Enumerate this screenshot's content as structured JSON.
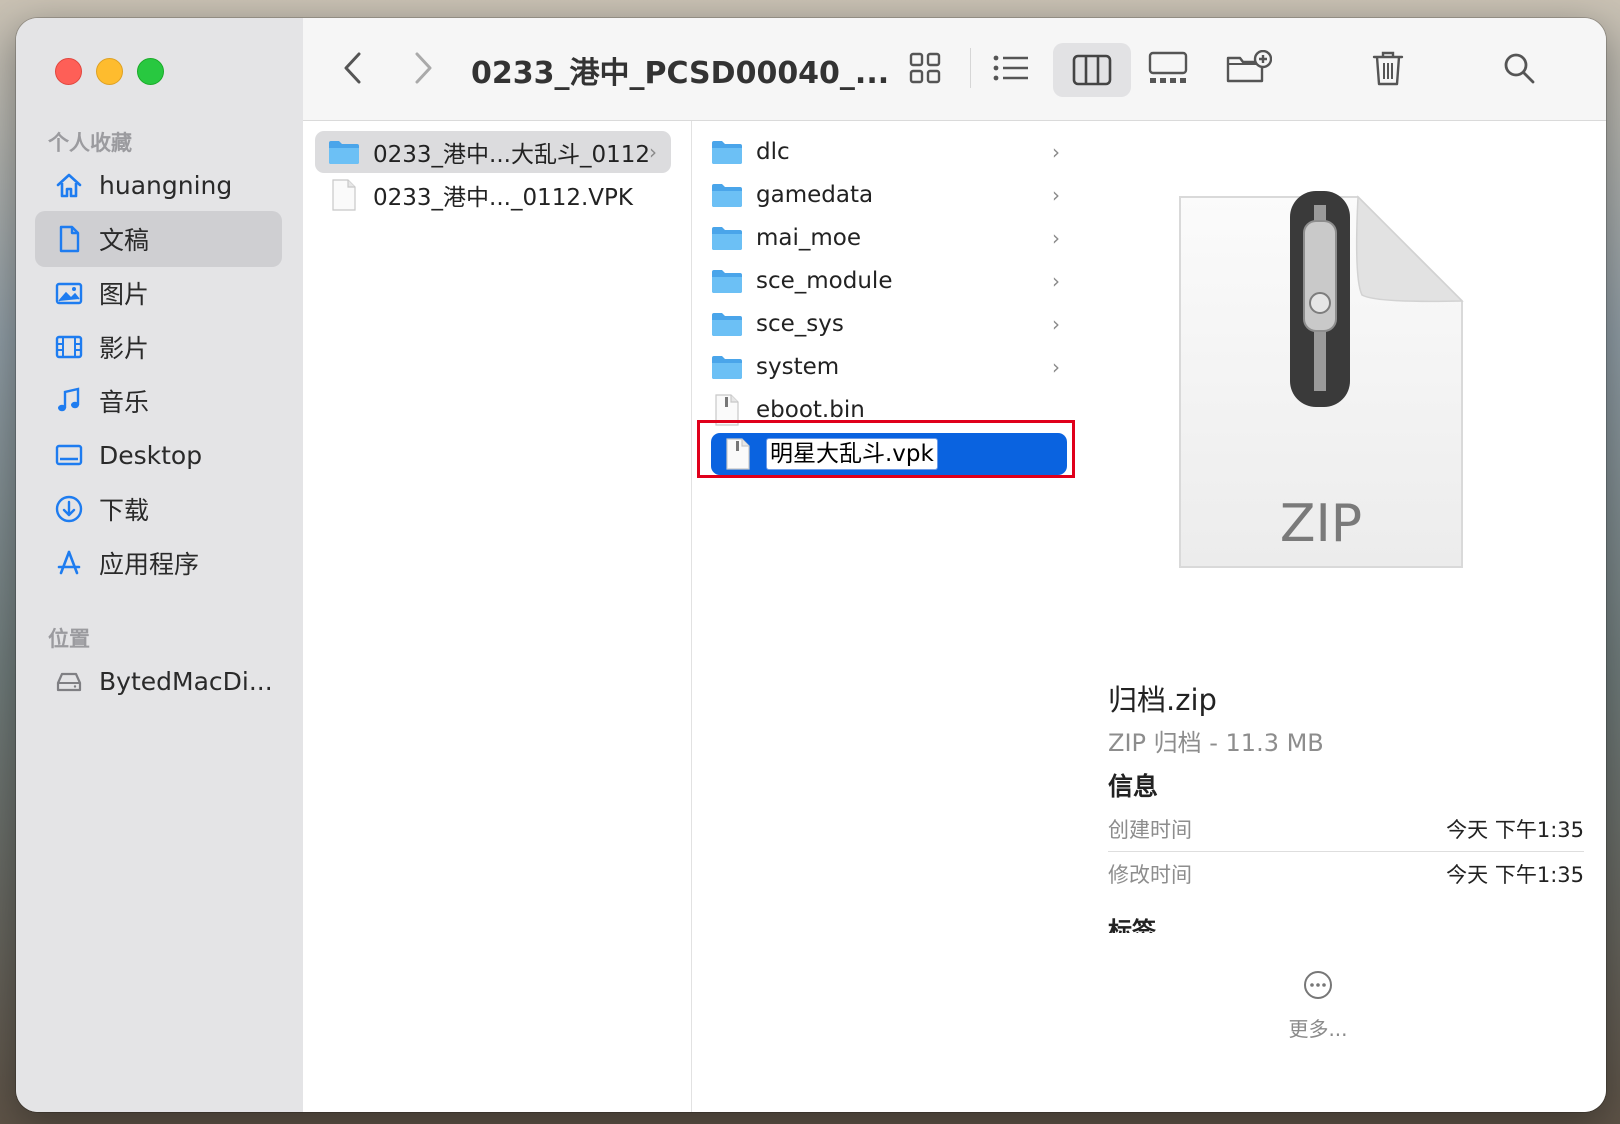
{
  "sidebar": {
    "favorites_header": "个人收藏",
    "locations_header": "位置",
    "items": [
      {
        "label": "huangning",
        "icon": "home-icon"
      },
      {
        "label": "文稿",
        "icon": "document-icon"
      },
      {
        "label": "图片",
        "icon": "photo-icon"
      },
      {
        "label": "影片",
        "icon": "film-icon"
      },
      {
        "label": "音乐",
        "icon": "music-note-icon"
      },
      {
        "label": "Desktop",
        "icon": "desktop-icon"
      },
      {
        "label": "下载",
        "icon": "download-icon"
      },
      {
        "label": "应用程序",
        "icon": "applications-icon"
      }
    ],
    "locations": [
      {
        "label": "BytedMacDi...",
        "icon": "disk-icon"
      }
    ]
  },
  "toolbar": {
    "title": "0233_港中_PCSD00040_..."
  },
  "column1": {
    "items": [
      {
        "label": "0233_港中...大乱斗_0112",
        "type": "folder"
      },
      {
        "label": "0233_港中..._0112.VPK",
        "type": "file"
      }
    ]
  },
  "column2": {
    "items": [
      {
        "label": "dlc",
        "type": "folder"
      },
      {
        "label": "gamedata",
        "type": "folder"
      },
      {
        "label": "mai_moe",
        "type": "folder"
      },
      {
        "label": "sce_module",
        "type": "folder"
      },
      {
        "label": "sce_sys",
        "type": "folder"
      },
      {
        "label": "system",
        "type": "folder"
      },
      {
        "label": "eboot.bin",
        "type": "file"
      },
      {
        "label": "明星大乱斗.vpk",
        "type": "file"
      }
    ]
  },
  "preview": {
    "thumb_label": "ZIP",
    "name": "归档.zip",
    "kind": "ZIP 归档 - 11.3 MB",
    "info_header": "信息",
    "created_label": "创建时间",
    "created_value": "今天 下午1:35",
    "modified_label": "修改时间",
    "modified_value": "今天 下午1:35",
    "tags_header": "标签",
    "more_label": "更多..."
  },
  "colors": {
    "selection_blue": "#0a63e0",
    "accent_icon": "#1e7cf0",
    "highlight_red": "#e0001b"
  }
}
